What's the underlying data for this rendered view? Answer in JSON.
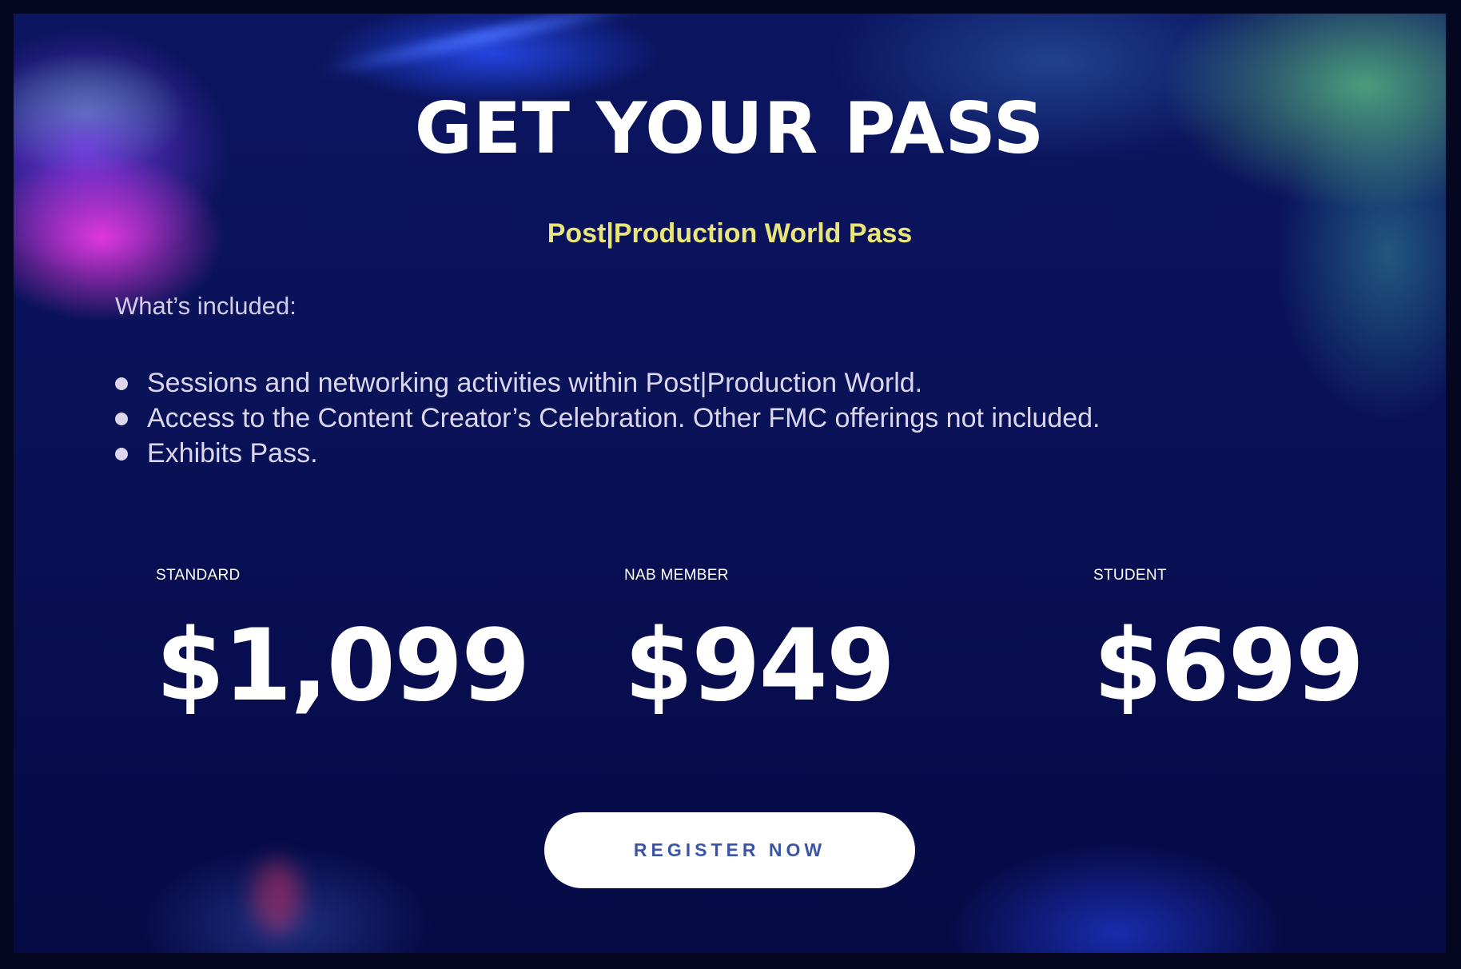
{
  "page": {
    "title": "GET YOUR PASS",
    "subtitle": "Post|Production World Pass"
  },
  "included": {
    "label": "What’s included:",
    "items": [
      "Sessions and networking activities within Post|Production World.",
      "Access to the Content Creator’s Celebration. Other FMC offerings not included.",
      "Exhibits Pass."
    ]
  },
  "pricing": {
    "tiers": [
      {
        "label": "STANDARD",
        "price": "$1,099"
      },
      {
        "label": "NAB MEMBER",
        "price": "$949"
      },
      {
        "label": "STUDENT",
        "price": "$699"
      }
    ]
  },
  "cta": {
    "register_label": "REGISTER NOW"
  },
  "colors": {
    "background": "#0a1258",
    "title": "#ffffff",
    "subtitle": "#e9e57a",
    "button_bg": "#ffffff",
    "button_text": "#3a55a8"
  }
}
